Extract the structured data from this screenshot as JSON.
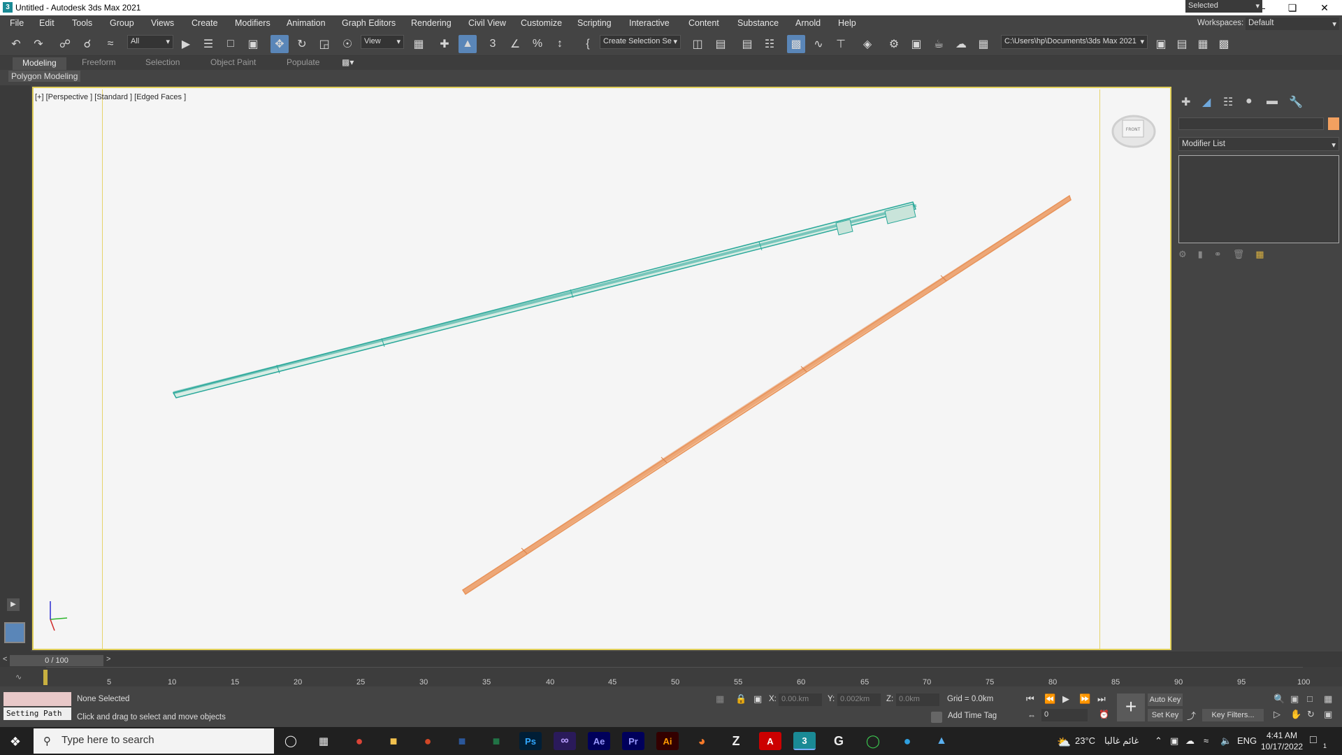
{
  "window": {
    "title": "Untitled - Autodesk 3ds Max 2021",
    "app_icon": "3"
  },
  "menu": [
    "File",
    "Edit",
    "Tools",
    "Group",
    "Views",
    "Create",
    "Modifiers",
    "Animation",
    "Graph Editors",
    "Rendering",
    "Civil View",
    "Customize",
    "Scripting",
    "Interactive",
    "Content",
    "Substance",
    "Arnold",
    "Help"
  ],
  "workspace": {
    "label": "Workspaces:",
    "value": "Default"
  },
  "toolbar": {
    "filter": "All",
    "ref_coord": "View",
    "selection_set": "Create Selection Se",
    "project_path": "C:\\Users\\hp\\Documents\\3ds Max 2021"
  },
  "ribbon": {
    "tabs": [
      "Modeling",
      "Freeform",
      "Selection",
      "Object Paint",
      "Populate"
    ],
    "active": "Modeling",
    "panel": "Polygon Modeling"
  },
  "viewport": {
    "label": "[+] [Perspective ] [Standard ] [Edged Faces ]",
    "viewcube_face": "FRONT"
  },
  "objects": [
    {
      "name": "toothpick-teal",
      "color": "#2aa89a"
    },
    {
      "name": "toothpick-orange",
      "color": "#e8935a"
    }
  ],
  "command_panel": {
    "modifier_list": "Modifier List",
    "object_color": "#f2a060"
  },
  "timeline": {
    "slider": "0 / 100",
    "ticks": [
      "5",
      "10",
      "15",
      "20",
      "25",
      "30",
      "35",
      "40",
      "45",
      "50",
      "55",
      "60",
      "65",
      "70",
      "75",
      "80",
      "85",
      "90",
      "95",
      "100"
    ]
  },
  "status": {
    "selection": "None Selected",
    "prompt": "Click and drag to select and move objects",
    "maxscript": "Setting Path",
    "x_label": "X:",
    "x_value": "0.00.km",
    "y_label": "Y:",
    "y_value": "0.002km",
    "z_label": "Z:",
    "z_value": "0.0km",
    "grid": "Grid = 0.0km",
    "add_time_tag": "Add Time Tag",
    "frame": "0",
    "auto_key": "Auto Key",
    "set_key": "Set Key",
    "key_mode": "Selected",
    "key_filters": "Key Filters..."
  },
  "taskbar": {
    "search_placeholder": "Type here to search",
    "apps": [
      "Ps",
      "Ae",
      "Pr",
      "Ai",
      "A"
    ],
    "weather": "23°C",
    "weather_text": "غائم غالبا",
    "language": "ENG",
    "time": "4:41 AM",
    "date": "10/17/2022",
    "notification_count": "1"
  }
}
